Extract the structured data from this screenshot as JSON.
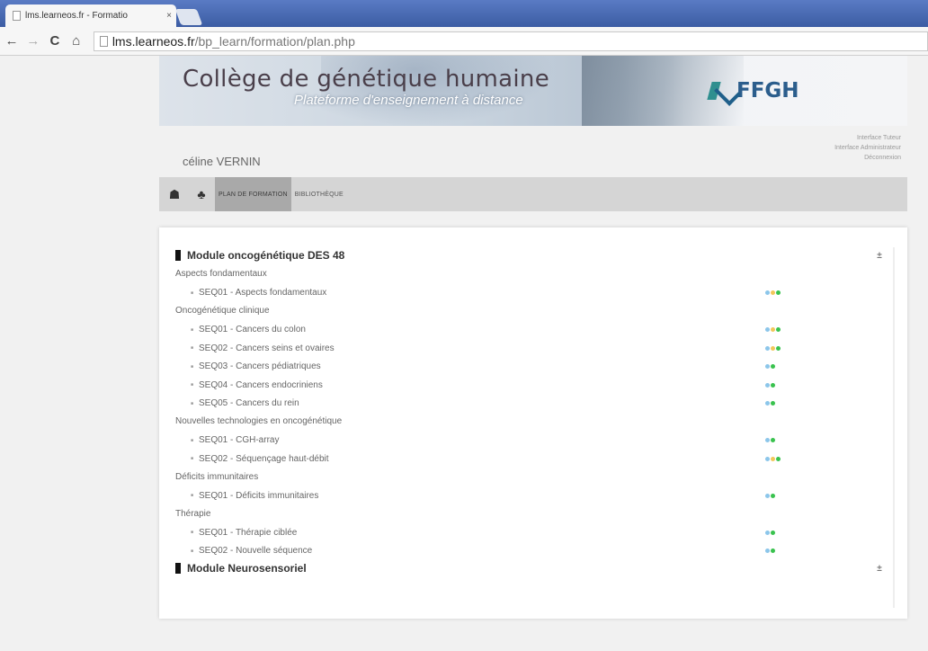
{
  "browser": {
    "tab_title": "lms.learneos.fr - Formatio",
    "tab_close": "×",
    "url_host": "lms.learneos.fr",
    "url_path": "/bp_learn/formation/plan.php"
  },
  "header": {
    "title": "Collège de génétique humaine",
    "subtitle": "Plateforme d'enseignement à distance",
    "logo_text": "FFGH",
    "user_name": "céline VERNIN",
    "links": [
      "Interface Tuteur",
      "Interface Administrateur",
      "Déconnexion"
    ]
  },
  "nav": {
    "home_icon": "home-icon",
    "graduation_icon": "graduation-cap-icon",
    "plan_label": "PLAN DE FORMATION",
    "library_label": "BIBLIOTHÈQUE"
  },
  "colors": {
    "dot_blue": "#8cc6ea",
    "dot_yellow": "#f1c75a",
    "dot_green": "#39c24e"
  },
  "modules": [
    {
      "title": "Module oncogénétique DES 48",
      "toggle": "±",
      "sections": [
        {
          "title": "Aspects fondamentaux",
          "items": [
            {
              "label": "SEQ01 - Aspects fondamentaux",
              "dots": [
                "blue",
                "yellow",
                "green"
              ]
            }
          ]
        },
        {
          "title": "Oncogénétique clinique",
          "items": [
            {
              "label": "SEQ01 - Cancers du colon",
              "dots": [
                "blue",
                "yellow",
                "green"
              ]
            },
            {
              "label": "SEQ02 - Cancers seins et ovaires",
              "dots": [
                "blue",
                "yellow",
                "green"
              ]
            },
            {
              "label": "SEQ03 - Cancers pédiatriques",
              "dots": [
                "blue",
                "green"
              ]
            },
            {
              "label": "SEQ04 - Cancers endocriniens",
              "dots": [
                "blue",
                "green"
              ]
            },
            {
              "label": "SEQ05 - Cancers du rein",
              "dots": [
                "blue",
                "green"
              ]
            }
          ]
        },
        {
          "title": "Nouvelles technologies en oncogénétique",
          "items": [
            {
              "label": "SEQ01 - CGH-array",
              "dots": [
                "blue",
                "green"
              ]
            },
            {
              "label": "SEQ02 - Séquençage haut-débit",
              "dots": [
                "blue",
                "yellow",
                "green"
              ]
            }
          ]
        },
        {
          "title": "Déficits immunitaires",
          "items": [
            {
              "label": "SEQ01 - Déficits immunitaires",
              "dots": [
                "blue",
                "green"
              ]
            }
          ]
        },
        {
          "title": "Thérapie",
          "items": [
            {
              "label": "SEQ01 - Thérapie ciblée",
              "dots": [
                "blue",
                "green"
              ]
            },
            {
              "label": "SEQ02 - Nouvelle séquence",
              "dots": [
                "blue",
                "green"
              ]
            }
          ]
        }
      ]
    },
    {
      "title": "Module Neurosensoriel",
      "toggle": "±",
      "sections": []
    }
  ]
}
